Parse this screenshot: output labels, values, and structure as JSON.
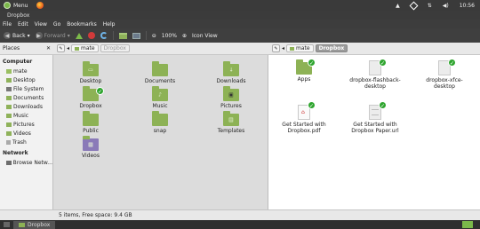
{
  "panel": {
    "menu_label": "Menu",
    "clock": "10:56"
  },
  "window": {
    "title": "Dropbox"
  },
  "menubar": {
    "items": [
      "File",
      "Edit",
      "View",
      "Go",
      "Bookmarks",
      "Help"
    ]
  },
  "toolbar": {
    "back_label": "Back",
    "forward_label": "Forward",
    "zoom": "100%",
    "view_mode": "Icon View"
  },
  "sidebar": {
    "header": "Places",
    "sections": [
      {
        "title": "Computer",
        "items": [
          "mate",
          "Desktop",
          "File System",
          "Documents",
          "Downloads",
          "Music",
          "Pictures",
          "Videos",
          "Trash"
        ]
      },
      {
        "title": "Network",
        "items": [
          "Browse Netw..."
        ]
      }
    ]
  },
  "left_pane": {
    "path": [
      "mate",
      "Dropbox"
    ],
    "items": [
      {
        "name": "Desktop",
        "glyph": ""
      },
      {
        "name": "Documents",
        "glyph": ""
      },
      {
        "name": "Downloads",
        "glyph": "↓"
      },
      {
        "name": "Dropbox",
        "glyph": ""
      },
      {
        "name": "Music",
        "glyph": "♪"
      },
      {
        "name": "Pictures",
        "glyph": ""
      },
      {
        "name": "Public",
        "glyph": ""
      },
      {
        "name": "snap",
        "glyph": ""
      },
      {
        "name": "Templates",
        "glyph": ""
      },
      {
        "name": "Videos",
        "glyph": ""
      }
    ],
    "status": "5 items, Free space: 9.4 GB"
  },
  "right_pane": {
    "path": [
      "mate",
      "Dropbox"
    ],
    "items": [
      {
        "name": "Apps",
        "kind": "folder"
      },
      {
        "name": "dropbox-flashback-desktop",
        "kind": "doc"
      },
      {
        "name": "dropbox-xfce-desktop",
        "kind": "doc"
      },
      {
        "name": "Get Started with Dropbox.pdf",
        "kind": "pdf"
      },
      {
        "name": "Get Started with Dropbox Paper.url",
        "kind": "doc"
      }
    ]
  },
  "taskbar": {
    "task_label": "Dropbox"
  },
  "colors": {
    "folder_green": "#8db255",
    "sync_check": "#2fa52f",
    "panel_dark": "#3a3a3a"
  }
}
